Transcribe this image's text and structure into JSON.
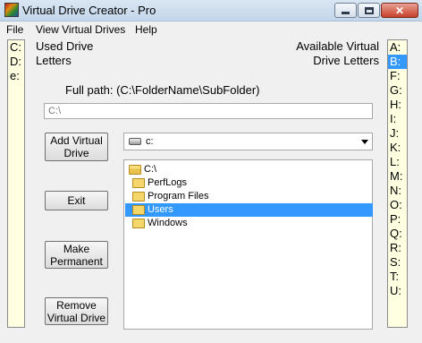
{
  "window": {
    "title": "Virtual Drive Creator - Pro",
    "close_glyph": "✕"
  },
  "menu": {
    "items": [
      "File",
      "View Virtual Drives",
      "Help"
    ]
  },
  "used_drives": {
    "label_line1": "Used Drive",
    "label_line2": "Letters",
    "letters": [
      "C:",
      "D:",
      "e:"
    ]
  },
  "available_drives": {
    "label_line1": "Available Virtual",
    "label_line2": "Drive Letters",
    "letters": [
      "A:",
      "B:",
      "F:",
      "G:",
      "H:",
      "I:",
      "J:",
      "K:",
      "L:",
      "M:",
      "N:",
      "O:",
      "P:",
      "Q:",
      "R:",
      "S:",
      "T:",
      "U:"
    ],
    "selected": "B:"
  },
  "path": {
    "label": "Full path: (C:\\FolderName\\SubFolder)",
    "value": "C:\\"
  },
  "buttons": {
    "add_line1": "Add Virtual",
    "add_line2": "Drive",
    "exit": "Exit",
    "make_permanent_line1": "Make",
    "make_permanent_line2": "Permanent",
    "remove_line1": "Remove",
    "remove_line2": "Virtual Drive"
  },
  "drive_select": {
    "value": "c:",
    "icon": "drive-icon"
  },
  "folder_tree": {
    "items": [
      {
        "label": "C:\\",
        "level": 0,
        "open": true
      },
      {
        "label": "PerfLogs",
        "level": 1,
        "open": false
      },
      {
        "label": "Program Files",
        "level": 1,
        "open": false
      },
      {
        "label": "Users",
        "level": 1,
        "open": false,
        "selected": true
      },
      {
        "label": "Windows",
        "level": 1,
        "open": false
      }
    ]
  },
  "colors": {
    "selection": "#3399ff",
    "list_background": "#ffffe1",
    "client_background": "#f0f0f0"
  }
}
